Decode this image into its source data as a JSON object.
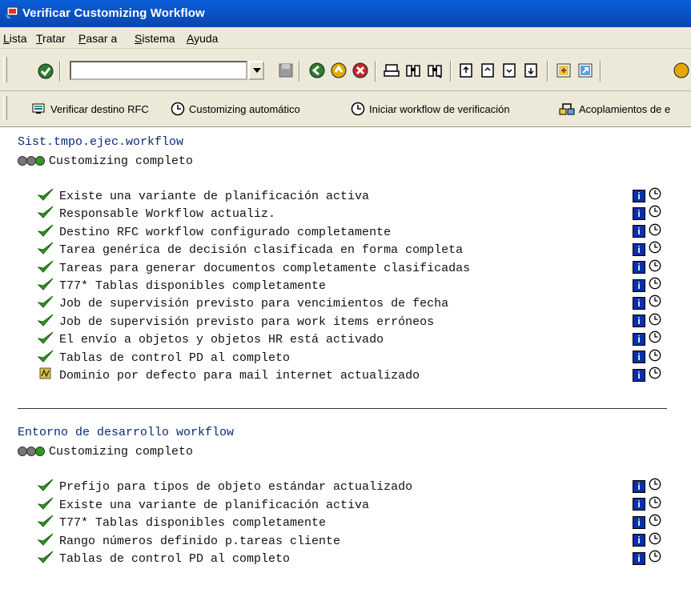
{
  "window": {
    "title": "Verificar Customizing Workflow"
  },
  "menu": [
    {
      "label": "Lista",
      "key": "L",
      "rest": "ista"
    },
    {
      "label": "Tratar",
      "key": "T",
      "rest": "ratar"
    },
    {
      "label": "Pasar a",
      "key": "P",
      "rest": "asar a"
    },
    {
      "label": "Sistema",
      "key": "S",
      "rest": "istema"
    },
    {
      "label": "Ayuda",
      "key": "A",
      "rest": "yuda"
    }
  ],
  "command_field": {
    "value": ""
  },
  "app_toolbar": {
    "rfc": "Verificar destino RFC",
    "auto": "Customizing automático",
    "start": "Iniciar workflow de verificación",
    "coupling": "Acoplamientos de e"
  },
  "sections": [
    {
      "title": "Sist.tmpo.ejec.workflow",
      "status": "Customizing completo",
      "items": [
        {
          "text": "Existe una variante de planificación activa",
          "state": "ok"
        },
        {
          "text": "Responsable Workflow actualiz.",
          "state": "ok"
        },
        {
          "text": "Destino RFC workflow configurado completamente",
          "state": "ok"
        },
        {
          "text": "Tarea genérica de decisión clasificada en forma completa",
          "state": "ok"
        },
        {
          "text": "Tareas para generar documentos completamente clasificadas",
          "state": "ok"
        },
        {
          "text": "T77* Tablas disponibles completamente",
          "state": "ok"
        },
        {
          "text": "Job de supervisión previsto para vencimientos de fecha",
          "state": "ok"
        },
        {
          "text": "Job de supervisión previsto para work items erróneos",
          "state": "ok"
        },
        {
          "text": "El envío a objetos y objetos HR está activado",
          "state": "ok"
        },
        {
          "text": "Tablas de control PD al completo",
          "state": "ok"
        },
        {
          "text": "Dominio por defecto para mail internet actualizado",
          "state": "warn"
        }
      ]
    },
    {
      "title": "Entorno de desarrollo workflow",
      "status": "Customizing completo",
      "items": [
        {
          "text": "Prefijo para tipos de objeto estándar actualizado",
          "state": "ok"
        },
        {
          "text": "Existe una variante de planificación activa",
          "state": "ok"
        },
        {
          "text": "T77* Tablas disponibles completamente",
          "state": "ok"
        },
        {
          "text": "Rango números definido p.tareas cliente",
          "state": "ok"
        },
        {
          "text": "Tablas de control PD al completo",
          "state": "ok"
        }
      ]
    }
  ],
  "colors": {
    "titlebar": "#0b4fc0",
    "heading": "#0a2a7a",
    "check": "#2e9a1f",
    "info_button": "#0a2fa8"
  },
  "icons": [
    "check-icon",
    "info-icon",
    "clock-icon",
    "traffic-light-icon",
    "warning-icon"
  ]
}
